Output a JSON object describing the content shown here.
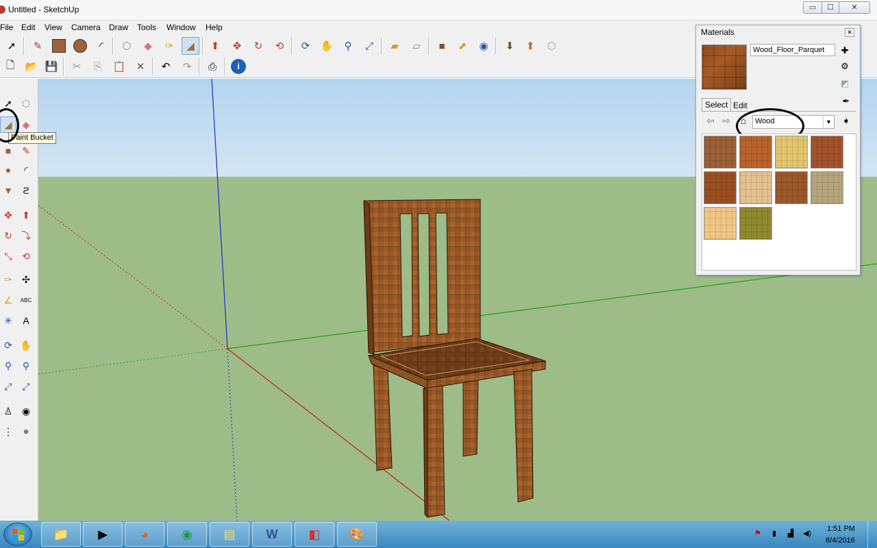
{
  "window": {
    "title": "Untitled - SketchUp",
    "minimize_glyph": "▭",
    "maximize_glyph": "☐",
    "close_glyph": "✕"
  },
  "menu": [
    "File",
    "Edit",
    "View",
    "Camera",
    "Draw",
    "Tools",
    "Window",
    "Help"
  ],
  "tooltip": {
    "text": "Paint Bucket"
  },
  "materials": {
    "title": "Materials",
    "close_glyph": "✕",
    "current_material": "Wood_Floor_Parquet",
    "tabs": {
      "select": "Select",
      "edit": "Edit"
    },
    "library": "Wood",
    "swatch_colors": [
      "#9a6037",
      "#b8622a",
      "#e1c46e",
      "#a2522a",
      "#9a4f22",
      "#e3c18f",
      "#9b5828",
      "#b5a47a",
      "#f0c685",
      "#8f8a2e"
    ]
  },
  "clock": {
    "time": "1:51 PM",
    "date": "8/4/2016"
  },
  "colors": {
    "sky": "#c6ddf1",
    "ground": "#9ebc88",
    "axis_blue": "#1a2cc8",
    "axis_green": "#1aa31a",
    "axis_red": "#c81a1a",
    "chair_wood": "#9a5a28"
  }
}
